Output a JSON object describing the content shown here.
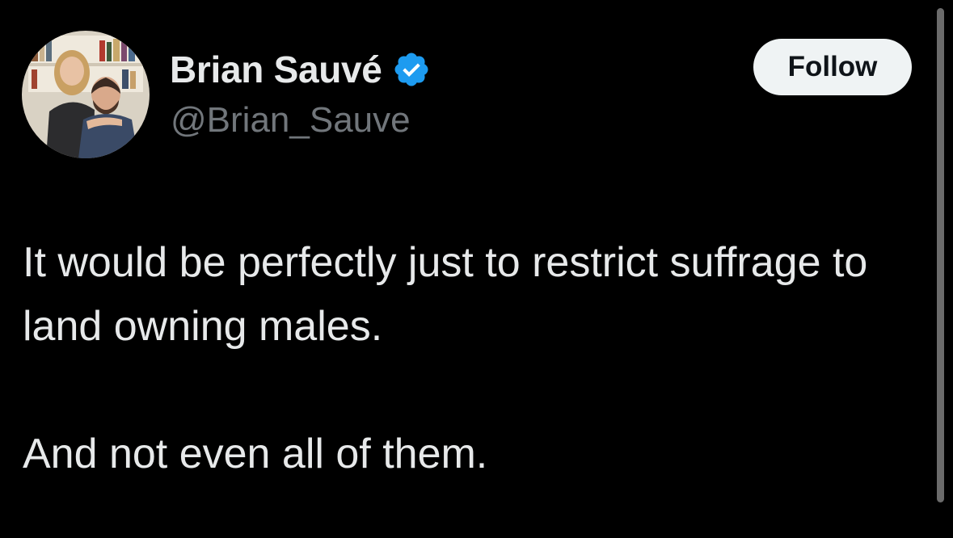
{
  "user": {
    "display_name": "Brian Sauvé",
    "handle": "@Brian_Sauve",
    "verified": true,
    "avatar_icon": "profile-photo-couple"
  },
  "follow_button": {
    "label": "Follow"
  },
  "tweet": {
    "lines": [
      "It would be perfectly just to restrict suffrage to land owning males.",
      "And not even all of them."
    ]
  },
  "colors": {
    "background": "#000000",
    "primary_text": "#e7e9ea",
    "secondary_text": "#71767b",
    "verified_badge": "#1d9bf0",
    "follow_button_bg": "#eff3f4",
    "follow_button_text": "#0f1419"
  }
}
